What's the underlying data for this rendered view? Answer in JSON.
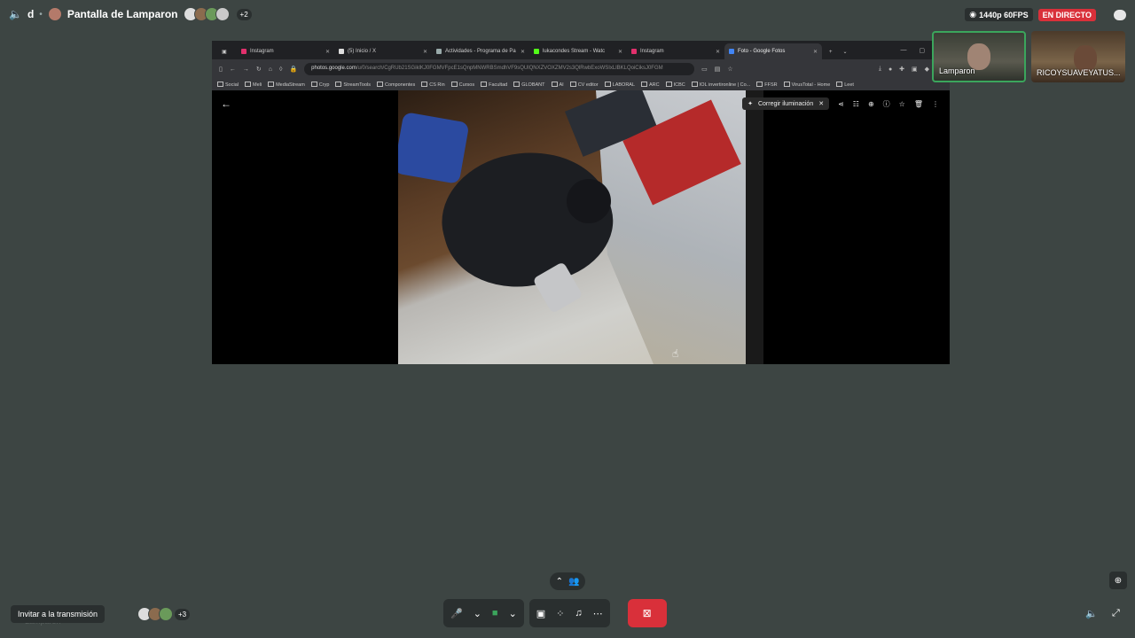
{
  "topbar": {
    "server_initial": "d",
    "stream_title": "Pantalla de Lamparon",
    "viewer_count_badge": "+2",
    "quality": "1440p 60FPS",
    "live_badge": "EN DIRECTO"
  },
  "browser": {
    "tabs": [
      {
        "label": "Instagram",
        "favicon": "instagram",
        "active": false
      },
      {
        "label": "(5) Inicio / X",
        "favicon": "x",
        "active": false
      },
      {
        "label": "Actividades - Programa de Pa",
        "favicon": "generic",
        "active": false
      },
      {
        "label": "lukacondes Stream - Watc",
        "favicon": "kick",
        "active": false
      },
      {
        "label": "Instagram",
        "favicon": "instagram",
        "active": false
      },
      {
        "label": "Foto - Google Fotos",
        "favicon": "google-photos",
        "active": true
      }
    ],
    "url_domain": "photos.google.com",
    "url_path": "/u/0/search/CgRUb21SGiklKJ0FGMVFpcE1sQnpMNWRBSmdhVF9sQUlQNXZVOXZMV2s3QlRwbExoWSIxLlBKLQoiCiksJ0FGM",
    "bookmarks": [
      "Social",
      "Meli",
      "MediaStream",
      "Cryp",
      "StreamTools",
      "Componentes",
      "CS Rin",
      "Cursos",
      "Facultad",
      "GLOBANT",
      "AI",
      "CV editor",
      "LABORAL",
      "ARC",
      "ICBC",
      "IOL invertironline | Co...",
      "FFSR",
      "VirusTotal - Home",
      "Leet"
    ]
  },
  "photo_viewer": {
    "fix_lighting_label": "Corregir iluminación"
  },
  "participants": [
    {
      "name": "Lamparon",
      "speaking": true
    },
    {
      "name": "RICOYSUAVEYATUS...",
      "speaking": false
    }
  ],
  "bottom": {
    "invite_label": "Invitar a la transmisión",
    "viewers_badge": "+3",
    "ghost_name": "Lamparon"
  },
  "colors": {
    "background": "#3d4543",
    "live": "#d9303a",
    "speaking": "#3ba55c",
    "end_call": "#d9303a"
  }
}
